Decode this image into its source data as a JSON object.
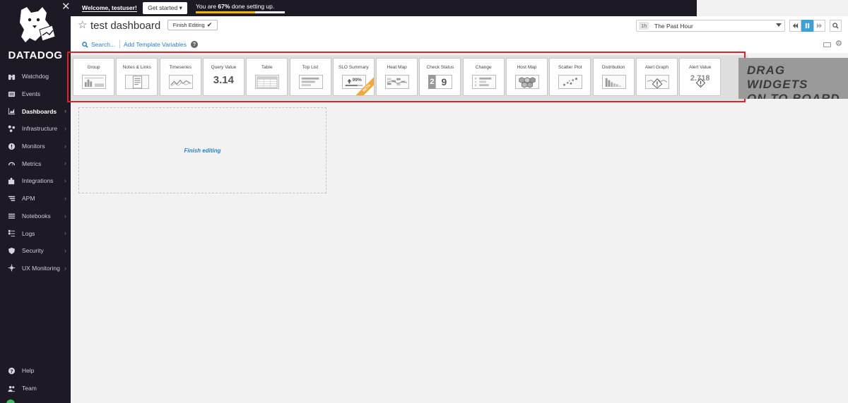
{
  "sidebar": {
    "logo_text": "DATADOG",
    "nav": [
      {
        "label": "Watchdog",
        "icon": "binoculars-icon",
        "chevron": false,
        "active": false
      },
      {
        "label": "Events",
        "icon": "events-icon",
        "chevron": false,
        "active": false
      },
      {
        "label": "Dashboards",
        "icon": "chart-icon",
        "chevron": true,
        "active": true
      },
      {
        "label": "Infrastructure",
        "icon": "hexagon-nodes-icon",
        "chevron": true,
        "active": false
      },
      {
        "label": "Monitors",
        "icon": "alert-circle-icon",
        "chevron": true,
        "active": false
      },
      {
        "label": "Metrics",
        "icon": "gauge-icon",
        "chevron": true,
        "active": false
      },
      {
        "label": "Integrations",
        "icon": "puzzle-icon",
        "chevron": true,
        "active": false
      },
      {
        "label": "APM",
        "icon": "apm-icon",
        "chevron": true,
        "active": false
      },
      {
        "label": "Notebooks",
        "icon": "notebook-icon",
        "chevron": true,
        "active": false
      },
      {
        "label": "Logs",
        "icon": "logs-icon",
        "chevron": true,
        "active": false
      },
      {
        "label": "Security",
        "icon": "shield-icon",
        "chevron": true,
        "active": false
      },
      {
        "label": "UX Monitoring",
        "icon": "ux-monitoring-icon",
        "chevron": true,
        "active": false
      }
    ],
    "bottom": [
      {
        "label": "Help",
        "icon": "help-icon"
      },
      {
        "label": "Team",
        "icon": "team-icon"
      }
    ]
  },
  "banner": {
    "welcome_prefix": "Welcome, ",
    "username": "testuser!",
    "get_started": "Get started ▾",
    "progress_prefix": "You are ",
    "progress_pct_text": "67%",
    "progress_suffix": " done setting up.",
    "progress_fraction": 0.67
  },
  "header": {
    "title": "test dashboard",
    "finish_editing": "Finish Editing",
    "time_badge": "1h",
    "time_label": "The Past Hour",
    "search_link": "Search...",
    "template_vars": "Add Template Variables",
    "help_mark": "?"
  },
  "widgets": [
    {
      "label": "Group",
      "thumb": "group"
    },
    {
      "label": "Notes & Links",
      "thumb": "notes"
    },
    {
      "label": "Timeseries",
      "thumb": "timeseries"
    },
    {
      "label": "Query Value",
      "thumb": "big",
      "big": "3.14"
    },
    {
      "label": "Table",
      "thumb": "table"
    },
    {
      "label": "Top List",
      "thumb": "toplist"
    },
    {
      "label": "SLO Summary",
      "thumb": "slo",
      "beta": "BETA"
    },
    {
      "label": "Heat Map",
      "thumb": "heatmap"
    },
    {
      "label": "Check Status",
      "thumb": "check"
    },
    {
      "label": "Change",
      "thumb": "change"
    },
    {
      "label": "Host Map",
      "thumb": "hostmap"
    },
    {
      "label": "Scatter Plot",
      "thumb": "scatter"
    },
    {
      "label": "Distribution",
      "thumb": "distribution"
    },
    {
      "label": "Alert Graph",
      "thumb": "alertgraph"
    },
    {
      "label": "Alert Value",
      "thumb": "alertvalue"
    }
  ],
  "slo_pct": "99%",
  "check_digits": [
    "2",
    "9"
  ],
  "alert_value_num": "2.718",
  "drag_hint_line1": "DRAG WIDGETS",
  "drag_hint_line2": "ON TO BOARD",
  "board": {
    "placeholder_link": "Finish editing"
  },
  "colors": {
    "sidebar_bg": "#1e1a25",
    "accent_blue": "#2a7fc0",
    "progress_yellow": "#f3b700",
    "highlight_red": "#e0202a",
    "beta_orange": "#f3a83b"
  }
}
